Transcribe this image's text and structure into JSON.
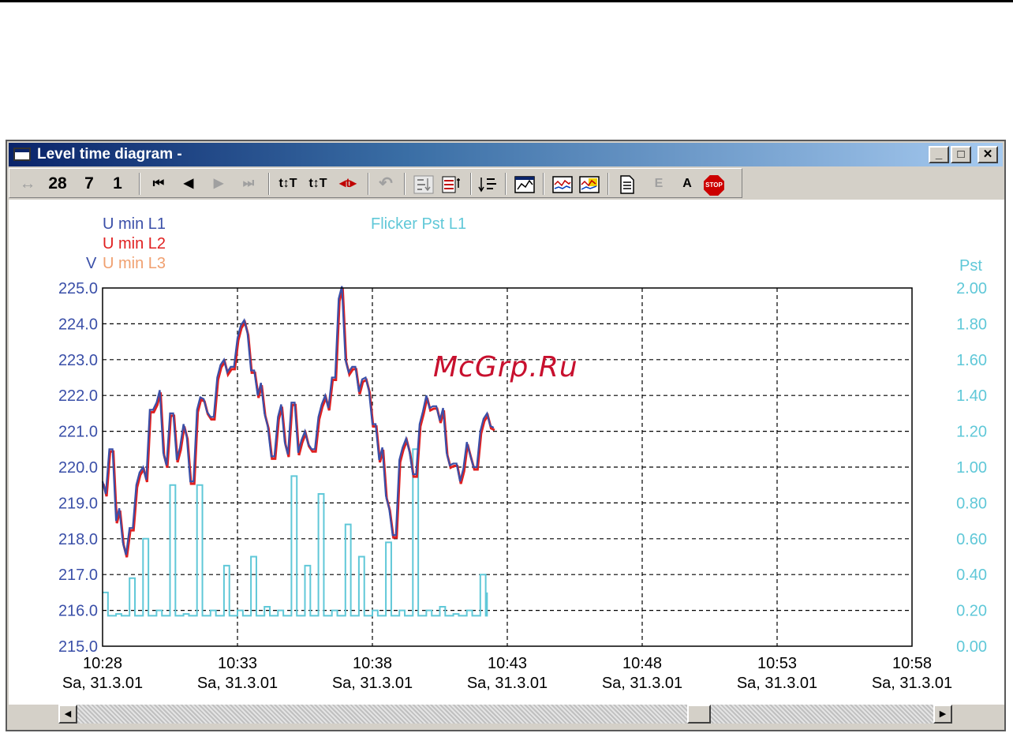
{
  "window": {
    "title": "Level time diagram -",
    "buttons": {
      "minimize": "_",
      "maximize": "□",
      "close": "✕"
    }
  },
  "toolbar": {
    "zoom_icon": "↔",
    "zoom_values": [
      "28",
      "7",
      "1"
    ],
    "nav_first": "⏮",
    "nav_prev": "◀",
    "nav_next": "▶",
    "nav_last": "⏭",
    "cursor1": "t↕T",
    "cursor2": "t↕T",
    "cursor3": "◂t▸",
    "undo": "↶",
    "icons": [
      "list-sort-icon",
      "table-icon",
      "sort-az-icon",
      "chart-icon",
      "graph-icon",
      "color-graph-icon",
      "document-icon"
    ],
    "text_e": "E",
    "text_a": "A",
    "stop_label": "STOP"
  },
  "chart": {
    "legend_left": [
      "U min L1",
      "U min L2",
      "U min L3"
    ],
    "legend_right": "Flicker Pst L1",
    "y_left_unit": "V",
    "y_right_unit": "Pst",
    "y_left_ticks": [
      "225.0",
      "224.0",
      "223.0",
      "222.0",
      "221.0",
      "220.0",
      "219.0",
      "218.0",
      "217.0",
      "216.0",
      "215.0"
    ],
    "y_right_ticks": [
      "2.00",
      "1.80",
      "1.60",
      "1.40",
      "1.20",
      "1.00",
      "0.80",
      "0.60",
      "0.40",
      "0.20",
      "0.00"
    ],
    "x_ticks": [
      {
        "time": "10:28",
        "date": "Sa, 31.3.01"
      },
      {
        "time": "10:33",
        "date": "Sa, 31.3.01"
      },
      {
        "time": "10:38",
        "date": "Sa, 31.3.01"
      },
      {
        "time": "10:43",
        "date": "Sa, 31.3.01"
      },
      {
        "time": "10:48",
        "date": "Sa, 31.3.01"
      },
      {
        "time": "10:53",
        "date": "Sa, 31.3.01"
      },
      {
        "time": "10:58",
        "date": "Sa, 31.3.01"
      }
    ],
    "colors": {
      "L1": "#3a4fa8",
      "L2": "#e02020",
      "L3": "#f0a070",
      "pst": "#60c8d8",
      "frame": "#000000"
    }
  },
  "chart_data": {
    "type": "line",
    "x_axis": {
      "label": "",
      "range": [
        "10:28",
        "10:58"
      ],
      "date": "Sa, 31.3.01"
    },
    "ylim_left": [
      215,
      225
    ],
    "ylim_right": [
      0,
      2
    ],
    "grid": true,
    "series": [
      {
        "name": "U min L1",
        "axis": "left",
        "x_minutes": [
          0,
          0.25,
          0.5,
          0.75,
          1,
          1.25,
          1.5,
          1.75,
          2,
          2.25,
          2.5,
          2.75,
          3,
          3.25,
          3.5,
          3.75,
          4,
          4.25,
          4.5,
          4.75,
          5,
          5.25,
          5.5,
          5.75,
          6,
          6.25,
          6.5,
          6.75,
          7,
          7.25,
          7.5,
          7.75,
          8,
          8.25,
          8.5,
          8.75,
          9,
          9.25,
          9.5,
          9.75,
          10,
          10.25,
          10.5,
          10.75,
          11,
          11.25,
          11.5,
          11.75,
          12,
          12.25,
          12.5,
          12.75,
          13,
          13.25,
          13.5,
          13.75,
          14,
          14.25,
          14.5
        ],
        "values": [
          219.6,
          220.5,
          218.5,
          217.9,
          218.3,
          219.5,
          220.0,
          221.6,
          221.8,
          220.4,
          221.5,
          220.2,
          221.2,
          219.6,
          221.6,
          221.9,
          221.4,
          222.5,
          223.0,
          222.8,
          223.6,
          224.1,
          222.7,
          222.0,
          221.5,
          220.3,
          221.4,
          220.7,
          221.8,
          220.4,
          221.0,
          220.5,
          221.4,
          222.0,
          222.5,
          224.7,
          223.0,
          222.8,
          222.1,
          222.5,
          221.2,
          220.2,
          219.2,
          218.1,
          220.2,
          220.8,
          219.8,
          221.2,
          222.0,
          221.7,
          221.3,
          220.4,
          220.1,
          219.6,
          220.7,
          220.0,
          221.0,
          221.5,
          221.1
        ]
      },
      {
        "name": "U min L2",
        "axis": "left",
        "note_values_track_L1": true,
        "values": []
      },
      {
        "name": "U min L3",
        "axis": "left",
        "values": []
      },
      {
        "name": "Flicker Pst L1",
        "axis": "right",
        "x_minutes": [
          0,
          0.5,
          1,
          1.5,
          2,
          2.5,
          3,
          3.5,
          4,
          4.5,
          5,
          5.5,
          6,
          6.5,
          7,
          7.5,
          8,
          8.5,
          9,
          9.5,
          10,
          10.5,
          11,
          11.5,
          12,
          12.5,
          13,
          13.5,
          14,
          14.25
        ],
        "values": [
          0.3,
          0.18,
          0.38,
          0.6,
          0.2,
          0.9,
          0.18,
          0.9,
          0.2,
          0.45,
          0.2,
          0.5,
          0.22,
          0.2,
          0.95,
          0.45,
          0.85,
          0.2,
          0.68,
          0.5,
          0.2,
          0.58,
          0.2,
          1.1,
          0.2,
          0.22,
          0.18,
          0.2,
          0.4,
          0.3
        ]
      }
    ]
  },
  "watermark": "McGrp.Ru"
}
